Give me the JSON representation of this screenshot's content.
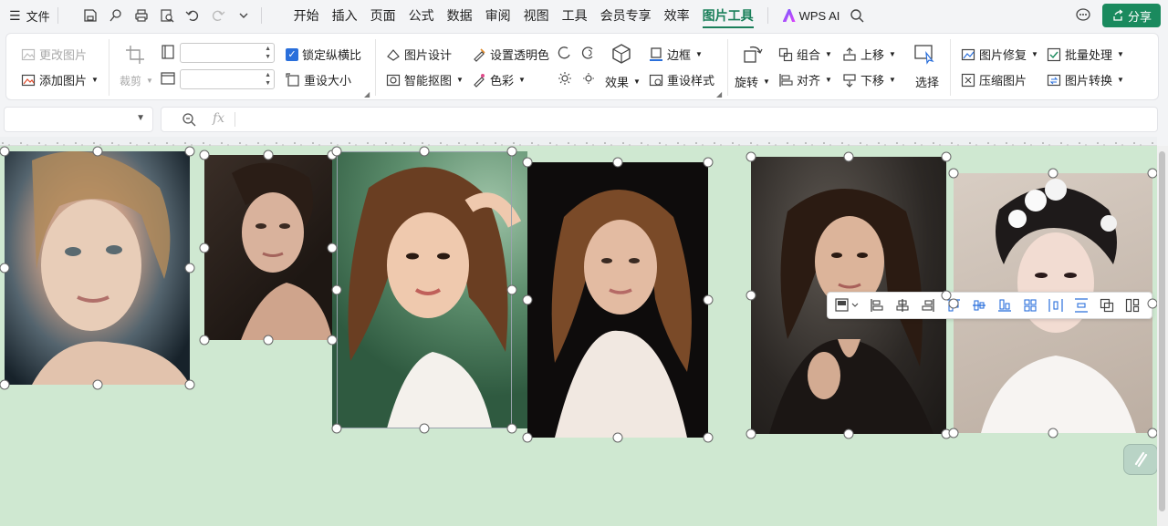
{
  "menubar": {
    "file_label": "文件",
    "tabs": [
      "开始",
      "插入",
      "页面",
      "公式",
      "数据",
      "审阅",
      "视图",
      "工具",
      "会员专享",
      "效率",
      "图片工具"
    ],
    "active_tab": "图片工具",
    "wps_ai": "WPS AI",
    "share": "分享"
  },
  "ribbon": {
    "change_picture": "更改图片",
    "add_picture": "添加图片",
    "crop": "裁剪",
    "width_value": "",
    "height_value": "",
    "lock_ratio": "锁定纵横比",
    "reset_size": "重设大小",
    "picture_design": "图片设计",
    "set_transparent": "设置透明色",
    "smart_cutout": "智能抠图",
    "color": "色彩",
    "effects": "效果",
    "border": "边框",
    "reset_style": "重设样式",
    "rotate": "旋转",
    "group": "组合",
    "align": "对齐",
    "move_up": "上移",
    "move_down": "下移",
    "select": "选择",
    "picture_repair": "图片修复",
    "batch_process": "批量处理",
    "compress_picture": "压缩图片",
    "picture_convert": "图片转换"
  },
  "formula": {
    "cell_ref": "",
    "fx": "fx",
    "content": ""
  },
  "colors": {
    "accent": "#1a7f5a",
    "share_bg": "#1a8a5e",
    "canvas": "#cfe8d1",
    "checkbox": "#2a6fdb"
  },
  "icons": [
    "save-icon",
    "print-icon",
    "undo-icon",
    "redo-icon",
    "search-icon",
    "feedback-icon",
    "share-icon",
    "ai-assistant-icon"
  ]
}
